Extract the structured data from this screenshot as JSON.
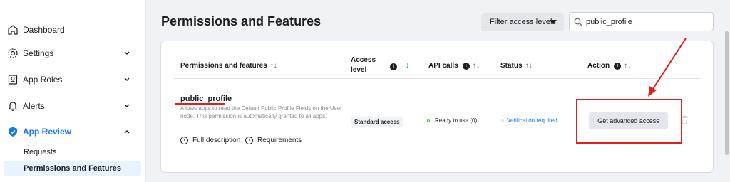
{
  "sidebar": {
    "items": [
      {
        "label": "Dashboard",
        "icon": "home-icon"
      },
      {
        "label": "Settings",
        "icon": "gear-icon"
      },
      {
        "label": "App Roles",
        "icon": "roles-icon"
      },
      {
        "label": "Alerts",
        "icon": "bell-icon"
      },
      {
        "label": "App Review",
        "icon": "shield-check-icon"
      }
    ],
    "subitems": [
      {
        "label": "Requests"
      },
      {
        "label": "Permissions and Features"
      }
    ]
  },
  "header": {
    "title": "Permissions and Features",
    "filter_label": "Filter access levels",
    "search_value": "public_profile"
  },
  "table": {
    "columns": {
      "permissions": "Permissions and features",
      "access_level": "Access level",
      "api_calls": "API calls",
      "status": "Status",
      "action": "Action"
    },
    "row": {
      "name": "public_profile",
      "description": "Allows apps to read the Default Public Profile Fields on the User node. This permission is automatically granted to all apps.",
      "full_description": "Full description",
      "requirements": "Requirements",
      "access": "Standard access",
      "api_calls": "Ready to use (0)",
      "status": "Verification required",
      "action_label": "Get advanced access"
    }
  },
  "colors": {
    "accent": "#1877f2",
    "annotation": "#e41e1e",
    "ready": "#42b72a"
  }
}
